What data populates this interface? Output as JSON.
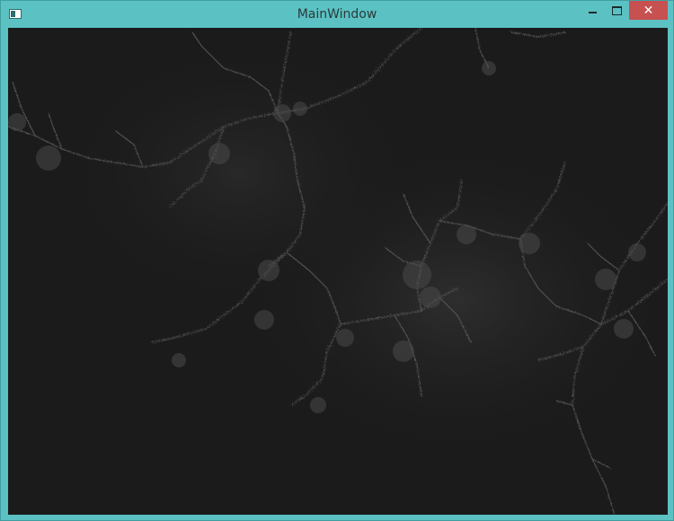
{
  "window": {
    "title": "MainWindow",
    "close_glyph": "✕",
    "accent_color": "#5bc1c3",
    "close_button_color": "#c75050"
  },
  "content": {
    "image_subject": "fractal",
    "background_color": "#1a1a1a"
  }
}
